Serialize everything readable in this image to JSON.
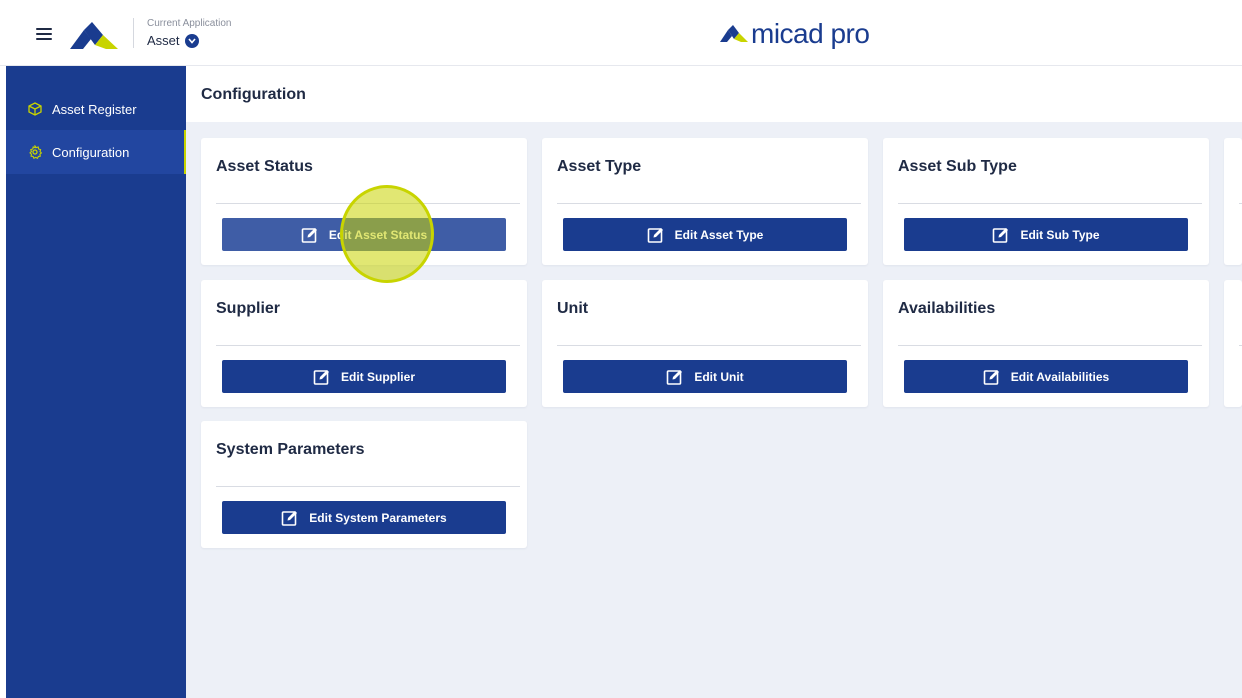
{
  "header": {
    "current_app_label": "Current Application",
    "app_name": "Asset",
    "brand_text": "micad pro",
    "colors": {
      "brand_blue": "#1a3c8f",
      "accent_green": "#c8d400"
    }
  },
  "sidebar": {
    "items": [
      {
        "label": "Asset Register",
        "icon": "cube-icon",
        "active": false
      },
      {
        "label": "Configuration",
        "icon": "gear-icon",
        "active": true
      }
    ]
  },
  "main": {
    "page_title": "Configuration",
    "cards": [
      {
        "title": "Asset Status",
        "button": "Edit Asset Status"
      },
      {
        "title": "Asset Type",
        "button": "Edit Asset Type"
      },
      {
        "title": "Asset Sub Type",
        "button": "Edit Sub Type"
      },
      {
        "title": "Supplier",
        "button": "Edit Supplier"
      },
      {
        "title": "Unit",
        "button": "Edit Unit"
      },
      {
        "title": "Availabilities",
        "button": "Edit Availabilities"
      },
      {
        "title": "System Parameters",
        "button": "Edit System Parameters"
      }
    ]
  }
}
